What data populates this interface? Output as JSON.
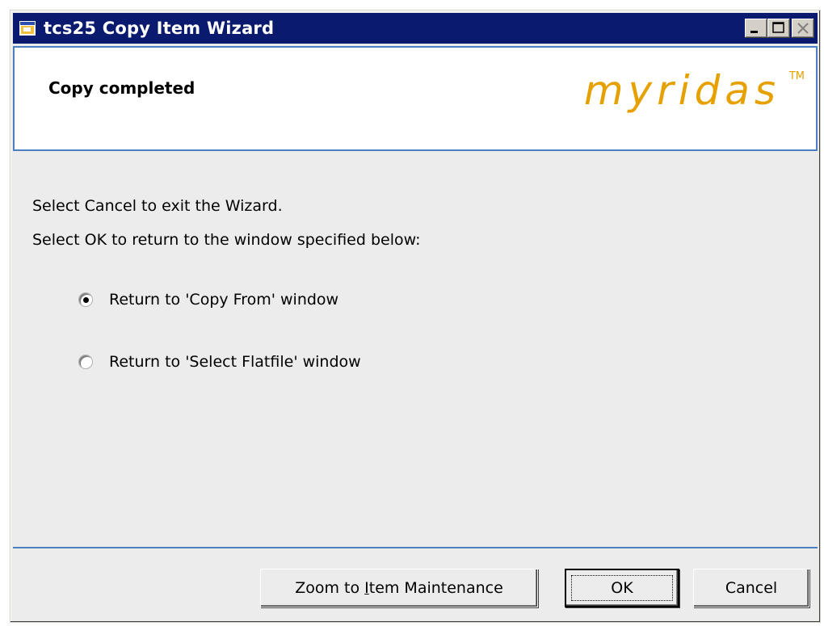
{
  "window": {
    "title": "tcs25 Copy Item Wizard"
  },
  "header": {
    "title": "Copy completed",
    "brand": "myridas",
    "trademark": "TM"
  },
  "content": {
    "line1": "Select Cancel to exit the Wizard.",
    "line2": "Select OK to return to the window specified below:"
  },
  "options": [
    {
      "label": "Return to 'Copy From' window",
      "selected": true
    },
    {
      "label": "Return to 'Select Flatfile' window",
      "selected": false
    }
  ],
  "buttons": {
    "zoom_prefix": "Zoom to ",
    "zoom_mnemonic": "I",
    "zoom_suffix": "tem Maintenance",
    "ok": "OK",
    "cancel": "Cancel"
  },
  "colors": {
    "titlebar": "#0a1a6e",
    "accent": "#4a7fc1",
    "brand": "#e6a100"
  },
  "icons": {
    "app": "app-window-icon",
    "minimize": "minimize-icon",
    "maximize": "maximize-icon",
    "close": "close-icon"
  }
}
